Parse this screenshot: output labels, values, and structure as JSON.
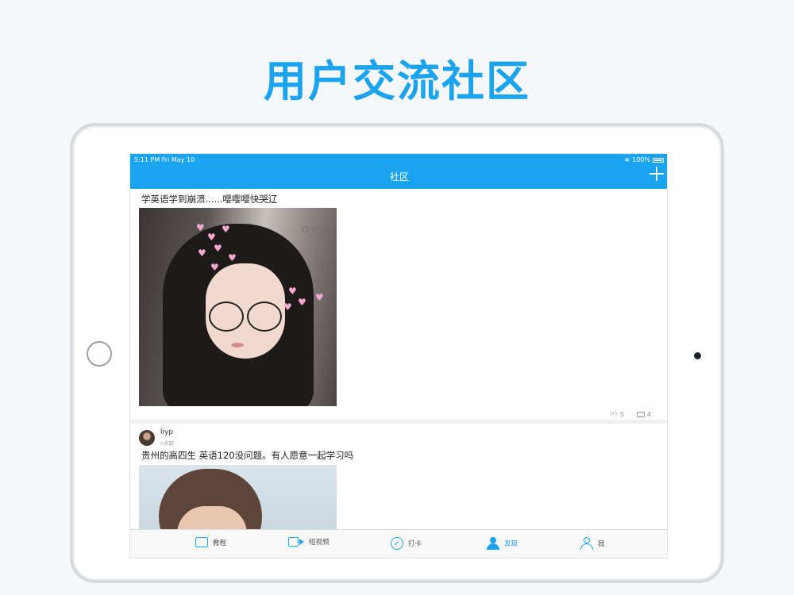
{
  "headline": "用户交流社区",
  "colors": {
    "accent": "#1aa3ee"
  },
  "status": {
    "time": "5:11 PM   Fri May 10",
    "battery": "100%"
  },
  "navbar": {
    "title": "社区",
    "add_icon": "plus-icon"
  },
  "posts": [
    {
      "text": "学英语学到崩溃......嘤嘤嘤快哭辽",
      "likes": "5",
      "comments": "4"
    },
    {
      "user": "liyp",
      "time": "n天前",
      "text": "贵州的高四生 英语120没问题。有人愿意一起学习吗"
    }
  ],
  "tabs": [
    {
      "label": "教程",
      "icon": "book-icon"
    },
    {
      "label": "短视频",
      "icon": "video-icon"
    },
    {
      "label": "打卡",
      "icon": "check-icon"
    },
    {
      "label": "发现",
      "icon": "discover-icon",
      "active": true
    },
    {
      "label": "我",
      "icon": "profile-icon"
    }
  ]
}
